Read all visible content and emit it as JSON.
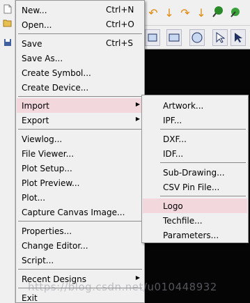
{
  "main_menu": {
    "new": {
      "label": "New...",
      "shortcut": "Ctrl+N"
    },
    "open": {
      "label": "Open...",
      "shortcut": "Ctrl+O"
    },
    "save": {
      "label": "Save",
      "shortcut": "Ctrl+S"
    },
    "save_as": {
      "label": "Save As..."
    },
    "create_symbol": {
      "label": "Create Symbol..."
    },
    "create_device": {
      "label": "Create Device..."
    },
    "import": {
      "label": "Import"
    },
    "export": {
      "label": "Export"
    },
    "viewlog": {
      "label": "Viewlog..."
    },
    "file_viewer": {
      "label": "File Viewer..."
    },
    "plot_setup": {
      "label": "Plot Setup..."
    },
    "plot_preview": {
      "label": "Plot Preview..."
    },
    "plot": {
      "label": "Plot..."
    },
    "capture_canvas": {
      "label": "Capture Canvas Image..."
    },
    "properties": {
      "label": "Properties..."
    },
    "change_editor": {
      "label": "Change Editor..."
    },
    "script": {
      "label": "Script..."
    },
    "recent_designs": {
      "label": "Recent Designs"
    },
    "exit": {
      "label": "Exit"
    }
  },
  "import_submenu": {
    "artwork": {
      "label": "Artwork..."
    },
    "ipf": {
      "label": "IPF..."
    },
    "dxf": {
      "label": "DXF..."
    },
    "idf": {
      "label": "IDF..."
    },
    "sub_drawing": {
      "label": "Sub-Drawing..."
    },
    "csv_pin_file": {
      "label": "CSV Pin File..."
    },
    "logo": {
      "label": "Logo"
    },
    "techfile": {
      "label": "Techfile..."
    },
    "parameters": {
      "label": "Parameters..."
    }
  },
  "watermark": "https://blog.csdn.net/u010448932",
  "colors": {
    "highlight": "#f2d7dc",
    "menu_bg": "#f0f0f0",
    "canvas": "#050505",
    "undo_orange": "#e08a10",
    "ok_green": "#2a8a2a"
  },
  "icons": [
    "new-file-icon",
    "open-folder-icon",
    "save-icon",
    "undo-icon",
    "redo-icon",
    "down-arrow-icon",
    "pushpin-icon",
    "rectangle-icon",
    "circle-icon",
    "select-arrow-icon"
  ]
}
